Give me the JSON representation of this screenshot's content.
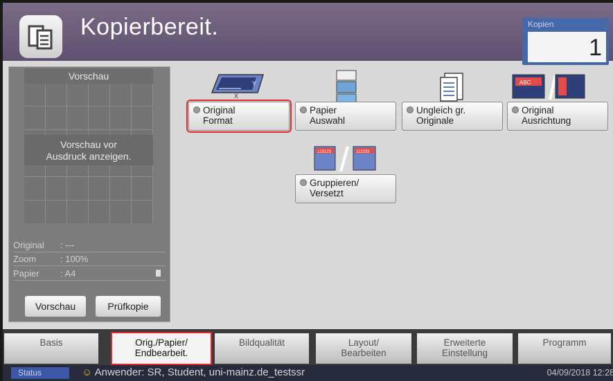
{
  "header": {
    "title": "Kopierbereit.",
    "copies_label": "Kopien",
    "copies_value": "1"
  },
  "preview": {
    "title": "Vorschau",
    "message_line1": "Vorschau vor",
    "message_line2": "Ausdruck anzeigen.",
    "info": [
      {
        "label": "Original",
        "value": ": ---"
      },
      {
        "label": "Zoom",
        "value": ": 100%"
      },
      {
        "label": "Papier",
        "value": ": A4"
      }
    ],
    "preview_button": "Vorschau",
    "proof_button": "Prüfkopie"
  },
  "functions": {
    "original_format": {
      "line1": "Original",
      "line2": "Format"
    },
    "paper_select": {
      "line1": "Papier",
      "line2": "Auswahl"
    },
    "mixed_originals": {
      "line1": "Ungleich gr.",
      "line2": "Originale"
    },
    "orientation": {
      "line1": "Original",
      "line2": "Ausrichtung"
    },
    "collate": {
      "line1": "Gruppieren/",
      "line2": "Versetzt"
    }
  },
  "tabs": [
    {
      "line1": "Basis",
      "line2": ""
    },
    {
      "line1": "Orig./Papier/",
      "line2": "Endbearbeit."
    },
    {
      "line1": "Bildqualität",
      "line2": ""
    },
    {
      "line1": "Layout/",
      "line2": "Bearbeiten"
    },
    {
      "line1": "Erweiterte",
      "line2": "Einstellung"
    },
    {
      "line1": "Programm",
      "line2": ""
    }
  ],
  "statusbar": {
    "status": "Status",
    "user": "Anwender: SR, Student, uni-mainz.de_testssr",
    "datetime": "04/09/2018 12:28"
  },
  "colors": {
    "header": "#6a5a7c",
    "accent_blue": "#4668a8",
    "selection": "#e0282e"
  }
}
